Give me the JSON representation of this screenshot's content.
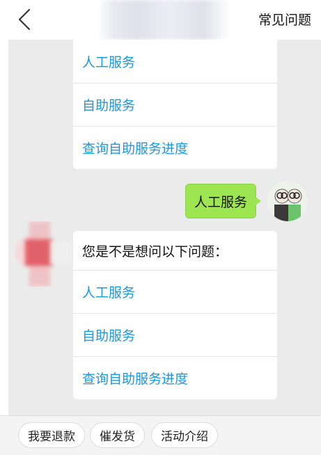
{
  "header": {
    "back_icon": "chevron-left-icon",
    "faq_label": "常见问题"
  },
  "top_card": {
    "items": [
      "人工服务",
      "自助服务",
      "查询自助服务进度"
    ]
  },
  "user_message": {
    "text": "人工服务",
    "bubble_color": "#9ee552"
  },
  "bottom_card": {
    "prompt": "您是不是想问以下问题：",
    "items": [
      "人工服务",
      "自助服务",
      "查询自助服务进度"
    ]
  },
  "quick_replies": [
    "我要退款",
    "催发货",
    "活动介绍"
  ],
  "colors": {
    "link": "#1a98e0",
    "background": "#ebebeb"
  }
}
